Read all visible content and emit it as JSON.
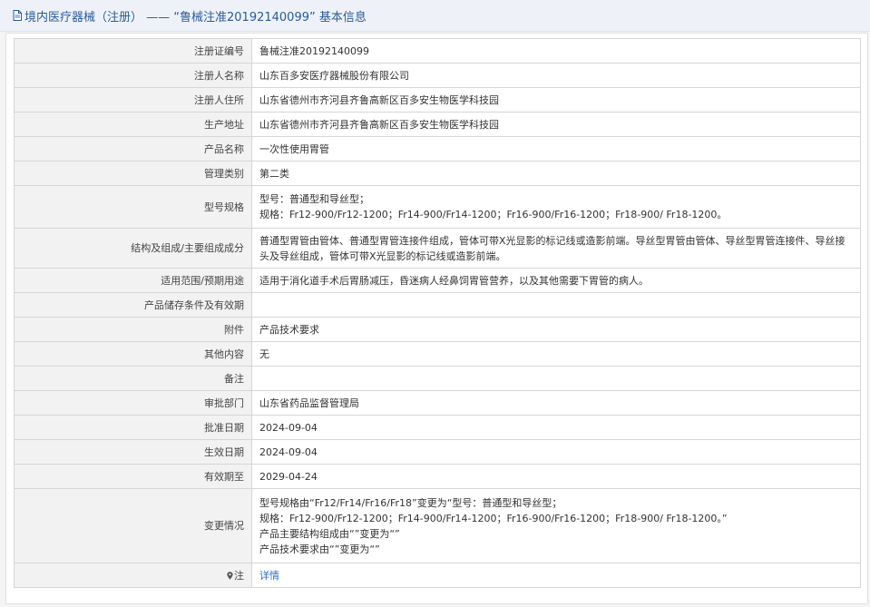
{
  "header": {
    "title": "境内医疗器械（注册） —— “鲁械注准20192140099” 基本信息",
    "icon": "document-icon"
  },
  "rows": [
    {
      "label": "注册证编号",
      "value": "鲁械注准20192140099"
    },
    {
      "label": "注册人名称",
      "value": "山东百多安医疗器械股份有限公司"
    },
    {
      "label": "注册人住所",
      "value": "山东省德州市齐河县齐鲁高新区百多安生物医学科技园"
    },
    {
      "label": "生产地址",
      "value": "山东省德州市齐河县齐鲁高新区百多安生物医学科技园"
    },
    {
      "label": "产品名称",
      "value": "一次性使用胃管"
    },
    {
      "label": "管理类别",
      "value": "第二类"
    },
    {
      "label": "型号规格",
      "lines": [
        "型号：普通型和导丝型；",
        "规格：Fr12-900/Fr12-1200；Fr14-900/Fr14-1200；Fr16-900/Fr16-1200；Fr18-900/ Fr18-1200。"
      ]
    },
    {
      "label": "结构及组成/主要组成成分",
      "lines": [
        "普通型胃管由管体、普通型胃管连接件组成，管体可带X光显影的标记线或造影前端。导丝型胃管由管体、导丝型胃管连接件、导丝接",
        "头及导丝组成，管体可带X光显影的标记线或造影前端。"
      ]
    },
    {
      "label": "适用范围/预期用途",
      "value": "适用于消化道手术后胃肠减压，昏迷病人经鼻饲胃管营养，以及其他需要下胃管的病人。"
    },
    {
      "label": "产品储存条件及有效期",
      "value": ""
    },
    {
      "label": "附件",
      "value": "产品技术要求"
    },
    {
      "label": "其他内容",
      "value": "无"
    },
    {
      "label": "备注",
      "value": ""
    },
    {
      "label": "审批部门",
      "value": "山东省药品监督管理局"
    },
    {
      "label": "批准日期",
      "value": "2024-09-04"
    },
    {
      "label": "生效日期",
      "value": "2024-09-04"
    },
    {
      "label": "有效期至",
      "value": "2029-04-24"
    },
    {
      "label": "变更情况",
      "lines": [
        "型号规格由“Fr12/Fr14/Fr16/Fr18”变更为“型号：普通型和导丝型；",
        "规格：Fr12-900/Fr12-1200；Fr14-900/Fr14-1200；Fr16-900/Fr16-1200；Fr18-900/ Fr18-1200。”",
        "产品主要结构组成由“”变更为“”",
        "产品技术要求由“”变更为“”"
      ]
    }
  ],
  "note": {
    "label": "注",
    "icon": "map-pin-icon",
    "link": "详情"
  },
  "colors": {
    "link": "#2b6cc4",
    "title": "#2a5b9c",
    "label_bg": "#f2f2f2",
    "border": "#d6d6d6"
  }
}
